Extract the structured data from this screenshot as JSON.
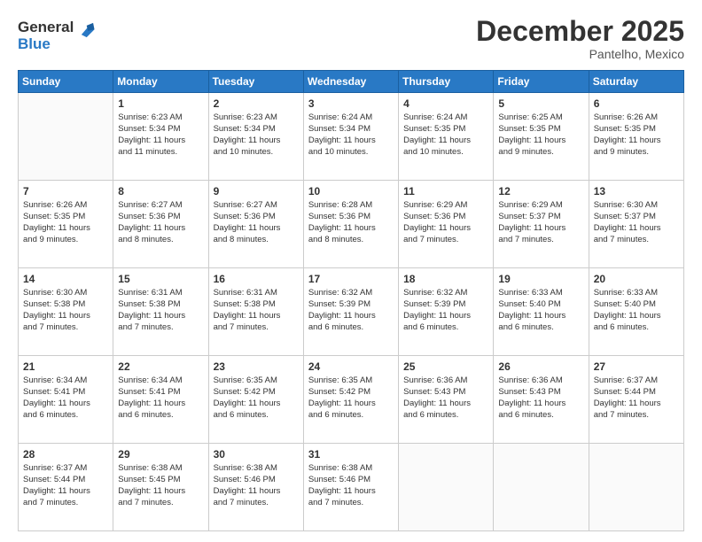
{
  "logo": {
    "general": "General",
    "blue": "Blue"
  },
  "header": {
    "month": "December 2025",
    "location": "Pantelho, Mexico"
  },
  "weekdays": [
    "Sunday",
    "Monday",
    "Tuesday",
    "Wednesday",
    "Thursday",
    "Friday",
    "Saturday"
  ],
  "weeks": [
    [
      {
        "day": "",
        "content": ""
      },
      {
        "day": "1",
        "content": "Sunrise: 6:23 AM\nSunset: 5:34 PM\nDaylight: 11 hours\nand 11 minutes."
      },
      {
        "day": "2",
        "content": "Sunrise: 6:23 AM\nSunset: 5:34 PM\nDaylight: 11 hours\nand 10 minutes."
      },
      {
        "day": "3",
        "content": "Sunrise: 6:24 AM\nSunset: 5:34 PM\nDaylight: 11 hours\nand 10 minutes."
      },
      {
        "day": "4",
        "content": "Sunrise: 6:24 AM\nSunset: 5:35 PM\nDaylight: 11 hours\nand 10 minutes."
      },
      {
        "day": "5",
        "content": "Sunrise: 6:25 AM\nSunset: 5:35 PM\nDaylight: 11 hours\nand 9 minutes."
      },
      {
        "day": "6",
        "content": "Sunrise: 6:26 AM\nSunset: 5:35 PM\nDaylight: 11 hours\nand 9 minutes."
      }
    ],
    [
      {
        "day": "7",
        "content": "Sunrise: 6:26 AM\nSunset: 5:35 PM\nDaylight: 11 hours\nand 9 minutes."
      },
      {
        "day": "8",
        "content": "Sunrise: 6:27 AM\nSunset: 5:36 PM\nDaylight: 11 hours\nand 8 minutes."
      },
      {
        "day": "9",
        "content": "Sunrise: 6:27 AM\nSunset: 5:36 PM\nDaylight: 11 hours\nand 8 minutes."
      },
      {
        "day": "10",
        "content": "Sunrise: 6:28 AM\nSunset: 5:36 PM\nDaylight: 11 hours\nand 8 minutes."
      },
      {
        "day": "11",
        "content": "Sunrise: 6:29 AM\nSunset: 5:36 PM\nDaylight: 11 hours\nand 7 minutes."
      },
      {
        "day": "12",
        "content": "Sunrise: 6:29 AM\nSunset: 5:37 PM\nDaylight: 11 hours\nand 7 minutes."
      },
      {
        "day": "13",
        "content": "Sunrise: 6:30 AM\nSunset: 5:37 PM\nDaylight: 11 hours\nand 7 minutes."
      }
    ],
    [
      {
        "day": "14",
        "content": "Sunrise: 6:30 AM\nSunset: 5:38 PM\nDaylight: 11 hours\nand 7 minutes."
      },
      {
        "day": "15",
        "content": "Sunrise: 6:31 AM\nSunset: 5:38 PM\nDaylight: 11 hours\nand 7 minutes."
      },
      {
        "day": "16",
        "content": "Sunrise: 6:31 AM\nSunset: 5:38 PM\nDaylight: 11 hours\nand 7 minutes."
      },
      {
        "day": "17",
        "content": "Sunrise: 6:32 AM\nSunset: 5:39 PM\nDaylight: 11 hours\nand 6 minutes."
      },
      {
        "day": "18",
        "content": "Sunrise: 6:32 AM\nSunset: 5:39 PM\nDaylight: 11 hours\nand 6 minutes."
      },
      {
        "day": "19",
        "content": "Sunrise: 6:33 AM\nSunset: 5:40 PM\nDaylight: 11 hours\nand 6 minutes."
      },
      {
        "day": "20",
        "content": "Sunrise: 6:33 AM\nSunset: 5:40 PM\nDaylight: 11 hours\nand 6 minutes."
      }
    ],
    [
      {
        "day": "21",
        "content": "Sunrise: 6:34 AM\nSunset: 5:41 PM\nDaylight: 11 hours\nand 6 minutes."
      },
      {
        "day": "22",
        "content": "Sunrise: 6:34 AM\nSunset: 5:41 PM\nDaylight: 11 hours\nand 6 minutes."
      },
      {
        "day": "23",
        "content": "Sunrise: 6:35 AM\nSunset: 5:42 PM\nDaylight: 11 hours\nand 6 minutes."
      },
      {
        "day": "24",
        "content": "Sunrise: 6:35 AM\nSunset: 5:42 PM\nDaylight: 11 hours\nand 6 minutes."
      },
      {
        "day": "25",
        "content": "Sunrise: 6:36 AM\nSunset: 5:43 PM\nDaylight: 11 hours\nand 6 minutes."
      },
      {
        "day": "26",
        "content": "Sunrise: 6:36 AM\nSunset: 5:43 PM\nDaylight: 11 hours\nand 6 minutes."
      },
      {
        "day": "27",
        "content": "Sunrise: 6:37 AM\nSunset: 5:44 PM\nDaylight: 11 hours\nand 7 minutes."
      }
    ],
    [
      {
        "day": "28",
        "content": "Sunrise: 6:37 AM\nSunset: 5:44 PM\nDaylight: 11 hours\nand 7 minutes."
      },
      {
        "day": "29",
        "content": "Sunrise: 6:38 AM\nSunset: 5:45 PM\nDaylight: 11 hours\nand 7 minutes."
      },
      {
        "day": "30",
        "content": "Sunrise: 6:38 AM\nSunset: 5:46 PM\nDaylight: 11 hours\nand 7 minutes."
      },
      {
        "day": "31",
        "content": "Sunrise: 6:38 AM\nSunset: 5:46 PM\nDaylight: 11 hours\nand 7 minutes."
      },
      {
        "day": "",
        "content": ""
      },
      {
        "day": "",
        "content": ""
      },
      {
        "day": "",
        "content": ""
      }
    ]
  ]
}
